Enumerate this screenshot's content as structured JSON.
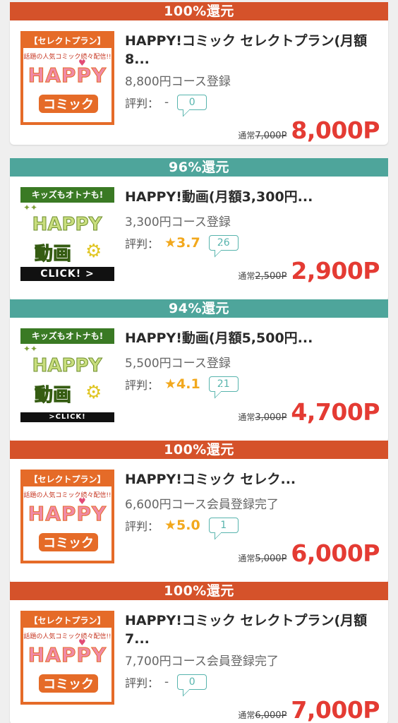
{
  "offers": [
    {
      "rate": "100%還元",
      "color": "orange",
      "thumb": "comic",
      "thumb_top": "【セレクトプラン】",
      "thumb_sub": "話題の人気コミック続々配信!!",
      "thumb_logo": "HAPPY",
      "thumb_word": "コミック",
      "title_line1": "HAPPY!コミック セレクトプラン(月額",
      "title_line2": "8...",
      "course": "8,800円コース登録",
      "rating_label": "評判：",
      "rating": "-",
      "reviews": "0",
      "normal_label": "通常",
      "normal_price": "7,000P",
      "point": "8,000P"
    },
    {
      "rate": "96%還元",
      "color": "teal",
      "thumb": "video",
      "thumb_top": "キッズもオトナも!",
      "thumb_logo": "HAPPY",
      "thumb_word": "動画",
      "thumb_click": "CLICK! >",
      "title_line1": "HAPPY!動画(月額3,300円...",
      "title_line2": "",
      "course": "3,300円コース登録",
      "rating_label": "評判：",
      "rating": "★3.7",
      "reviews": "26",
      "normal_label": "通常",
      "normal_price": "2,500P",
      "point": "2,900P"
    },
    {
      "rate": "94%還元",
      "color": "teal",
      "thumb": "video",
      "thumb_top": "キッズもオトナも!",
      "thumb_logo": "HAPPY",
      "thumb_word": "動画",
      "thumb_click": ">CLICK!",
      "title_line1": "HAPPY!動画(月額5,500円...",
      "title_line2": "",
      "course": "5,500円コース登録",
      "rating_label": "評判：",
      "rating": "★4.1",
      "reviews": "21",
      "normal_label": "通常",
      "normal_price": "3,000P",
      "point": "4,700P"
    },
    {
      "rate": "100%還元",
      "color": "orange",
      "thumb": "comic",
      "thumb_top": "【セレクトプラン】",
      "thumb_sub": "話題の人気コミック続々配信!!",
      "thumb_logo": "HAPPY",
      "thumb_word": "コミック",
      "title_line1": "HAPPY!コミック セレク...",
      "title_line2": "",
      "course": "6,600円コース会員登録完了",
      "rating_label": "評判：",
      "rating": "★5.0",
      "reviews": "1",
      "normal_label": "通常",
      "normal_price": "5,000P",
      "point": "6,000P"
    },
    {
      "rate": "100%還元",
      "color": "orange",
      "thumb": "comic",
      "thumb_top": "【セレクトプラン】",
      "thumb_sub": "話題の人気コミック続々配信!!",
      "thumb_logo": "HAPPY",
      "thumb_word": "コミック",
      "title_line1": "HAPPY!コミック セレクトプラン(月額",
      "title_line2": "7...",
      "course": "7,700円コース会員登録完了",
      "rating_label": "評判：",
      "rating": "-",
      "reviews": "0",
      "normal_label": "通常",
      "normal_price": "6,000P",
      "point": "7,000P"
    }
  ]
}
